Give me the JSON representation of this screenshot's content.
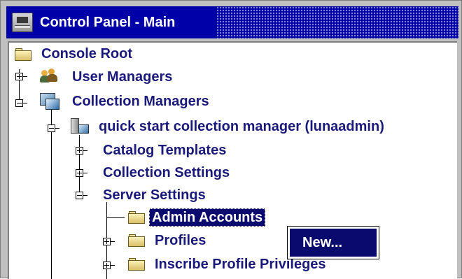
{
  "window": {
    "title": "Control Panel - Main",
    "icon": "admin-console-icon"
  },
  "tree": {
    "console_root": "Console Root",
    "user_managers": "User Managers",
    "collection_managers": "Collection Managers",
    "quick_start": "quick start collection manager (lunaadmin)",
    "catalog_templates": "Catalog Templates",
    "collection_settings": "Collection Settings",
    "server_settings": "Server Settings",
    "admin_accounts": "Admin Accounts",
    "profiles": "Profiles",
    "inscribe_profile_privileges": "Inscribe Profile Privileges"
  },
  "context_menu": {
    "new_label": "New..."
  },
  "colors": {
    "selection": "#0a0a6e",
    "label_text": "#1a1a7a",
    "titlebar": "#0000a8"
  }
}
